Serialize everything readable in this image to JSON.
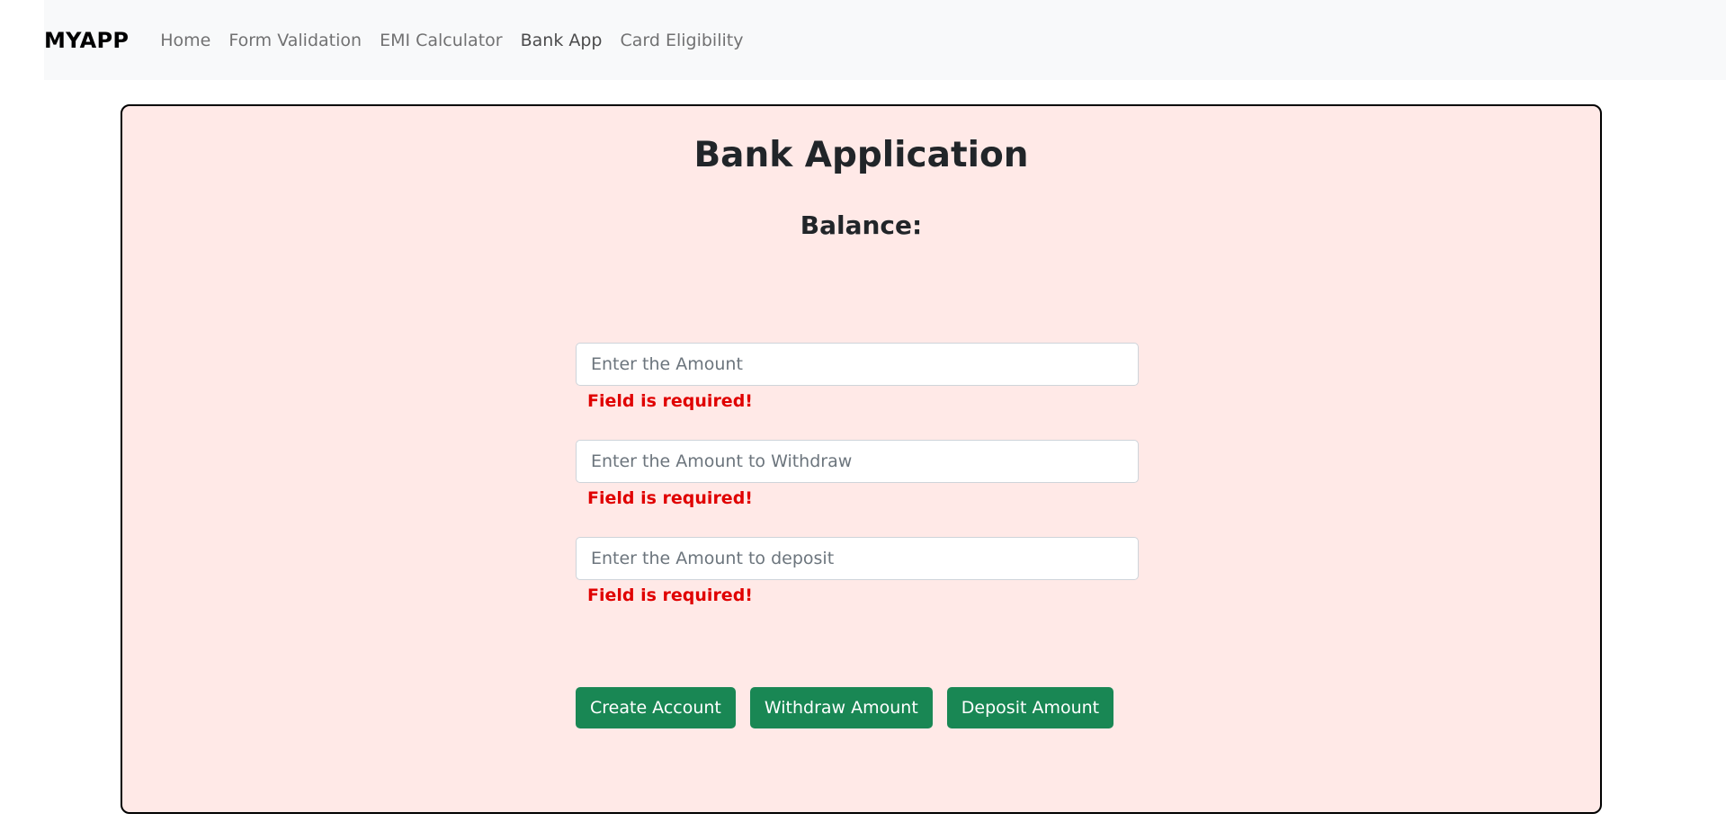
{
  "navbar": {
    "brand": "MYAPP",
    "links": [
      {
        "label": "Home"
      },
      {
        "label": "Form Validation"
      },
      {
        "label": "EMI Calculator"
      },
      {
        "label": "Bank App"
      },
      {
        "label": "Card Eligibility"
      }
    ],
    "active": "Bank App"
  },
  "main": {
    "title": "Bank Application",
    "balance_label": "Balance:",
    "fields": [
      {
        "placeholder": "Enter the Amount",
        "value": "",
        "error": "Field is required!"
      },
      {
        "placeholder": "Enter the Amount to Withdraw",
        "value": "",
        "error": "Field is required!"
      },
      {
        "placeholder": "Enter the Amount to deposit",
        "value": "",
        "error": "Field is required!"
      }
    ],
    "buttons": {
      "create": "Create Account",
      "withdraw": "Withdraw Amount",
      "deposit": "Deposit Amount"
    }
  },
  "colors": {
    "card_background": "#ffe9e7",
    "button": "#198754",
    "error": "#e00000",
    "navbar": "#f8f9fa"
  }
}
